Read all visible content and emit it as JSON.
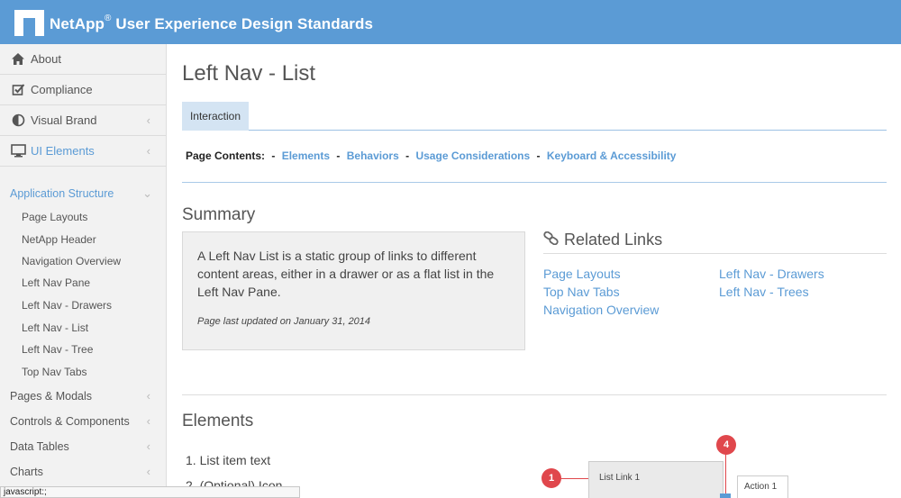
{
  "header": {
    "brand": "NetApp",
    "reg": "®",
    "subtitle": " User Experience Design Standards"
  },
  "sidebar": {
    "top_items": [
      {
        "label": "About",
        "icon": "home-icon"
      },
      {
        "label": "Compliance",
        "icon": "checkbox-icon"
      },
      {
        "label": "Visual Brand",
        "icon": "contrast-icon"
      },
      {
        "label": "UI Elements",
        "icon": "monitor-icon"
      }
    ],
    "section": "Application Structure",
    "sub_items": [
      "Page Layouts",
      "NetApp Header",
      "Navigation Overview",
      "Left Nav Pane",
      "Left Nav - Drawers",
      "Left Nav - List",
      "Left Nav - Tree",
      "Top Nav Tabs"
    ],
    "groups": [
      "Pages & Modals",
      "Controls & Components",
      "Data Tables",
      "Charts"
    ]
  },
  "page": {
    "title": "Left Nav - List",
    "tab": "Interaction",
    "contents_label": "Page Contents:",
    "contents_links": [
      "Elements",
      "Behaviors",
      "Usage Considerations",
      "Keyboard & Accessibility"
    ],
    "separator": "-"
  },
  "summary": {
    "heading": "Summary",
    "text": "A Left Nav List is a static group of links to different content areas, either in a drawer or as a flat list in the Left Nav Pane.",
    "updated": "Page last updated on January 31, 2014"
  },
  "related": {
    "heading": "Related Links",
    "col1": [
      "Page Layouts",
      "Top Nav Tabs",
      "Navigation Overview"
    ],
    "col2": [
      "Left Nav - Drawers",
      "Left Nav - Trees"
    ]
  },
  "elements": {
    "heading": "Elements",
    "items": [
      "1. List item text",
      "2. (Optional) Icon"
    ]
  },
  "diagram": {
    "link": "List Link 1",
    "action": "Action 1",
    "marker1": "1",
    "marker4": "4"
  },
  "status": "javascript:;"
}
